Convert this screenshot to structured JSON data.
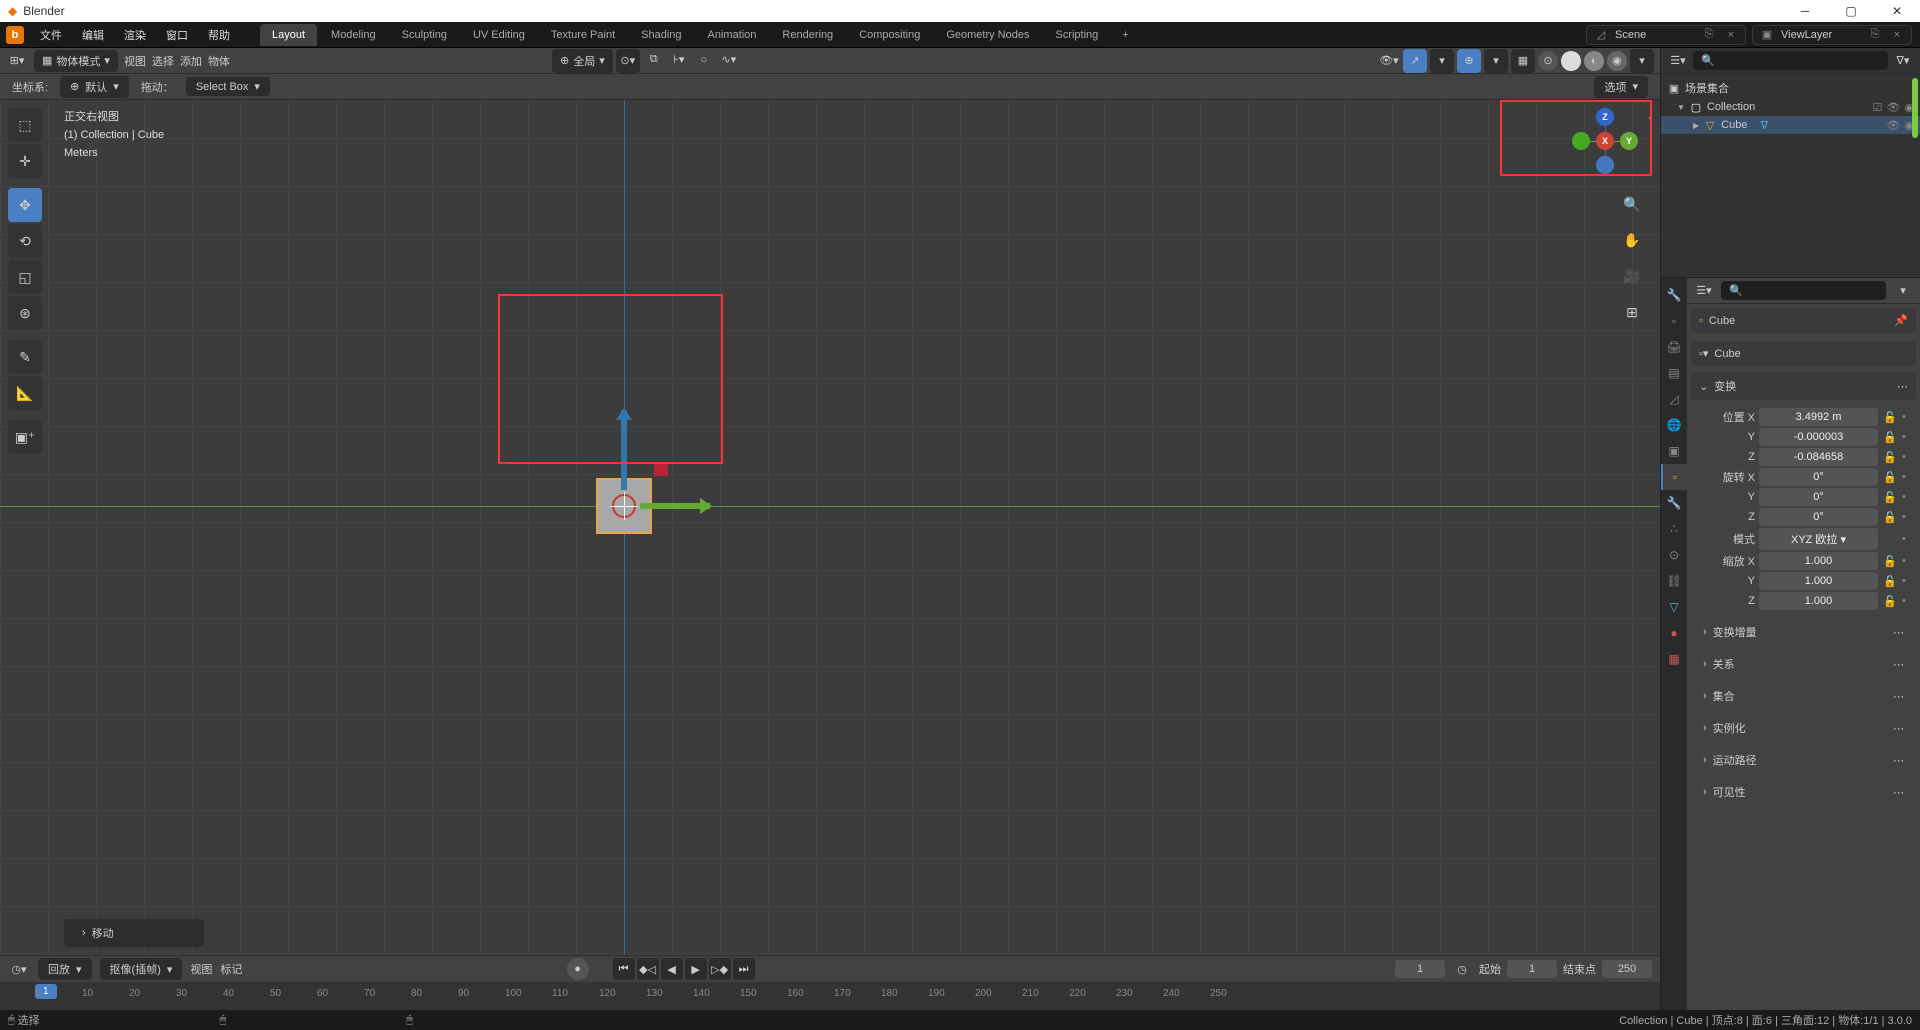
{
  "app_title": "Blender",
  "menu": {
    "file": "文件",
    "edit": "编辑",
    "render": "渲染",
    "window": "窗口",
    "help": "帮助"
  },
  "tabs": [
    "Layout",
    "Modeling",
    "Sculpting",
    "UV Editing",
    "Texture Paint",
    "Shading",
    "Animation",
    "Rendering",
    "Compositing",
    "Geometry Nodes",
    "Scripting"
  ],
  "scene_name": "Scene",
  "viewlayer_name": "ViewLayer",
  "vp_header": {
    "mode": "物体模式",
    "view": "视图",
    "select": "选择",
    "add": "添加",
    "object": "物体",
    "orient": "全局"
  },
  "vp_header2": {
    "coord": "坐标系:",
    "orient": "默认",
    "drag": "拖动：",
    "dragbox": "Select Box",
    "options": "选项"
  },
  "vp_info": {
    "view": "正交右视图",
    "path": "(1) Collection | Cube",
    "units": "Meters"
  },
  "op_panel": "移动",
  "timeline": {
    "playback": "回放",
    "keying": "抠像(插帧)",
    "view": "视图",
    "marker": "标记",
    "current": "1",
    "start_lbl": "起始",
    "start": "1",
    "end_lbl": "结束点",
    "end": "250",
    "frames": [
      "1",
      "10",
      "20",
      "30",
      "40",
      "50",
      "60",
      "70",
      "80",
      "90",
      "100",
      "110",
      "120",
      "130",
      "140",
      "150",
      "160",
      "170",
      "180",
      "190",
      "200",
      "210",
      "220",
      "230",
      "240",
      "250"
    ]
  },
  "outliner": {
    "root": "场景集合",
    "collection": "Collection",
    "cube": "Cube"
  },
  "props": {
    "cube_name": "Cube",
    "cube_data": "Cube",
    "transform": "变换",
    "loc": {
      "x_lbl": "位置 X",
      "x": "3.4992 m",
      "y_lbl": "Y",
      "y": "-0.000003",
      "z_lbl": "Z",
      "z": "-0.084658"
    },
    "rot": {
      "x_lbl": "旋转 X",
      "x": "0°",
      "y_lbl": "Y",
      "y": "0°",
      "z_lbl": "Z",
      "z": "0°",
      "mode_lbl": "模式",
      "mode": "XYZ 欧拉"
    },
    "scale": {
      "x_lbl": "缩放 X",
      "x": "1.000",
      "y_lbl": "Y",
      "y": "1.000",
      "z_lbl": "Z",
      "z": "1.000"
    },
    "delta": "变换增量",
    "relations": "关系",
    "collections": "集合",
    "instancing": "实例化",
    "motion": "运动路径",
    "vis": "可见性"
  },
  "status": {
    "select": "选择",
    "right": "Collection | Cube | 顶点:8 | 面:6 | 三角面:12 | 物体:1/1 | 3.0.0"
  }
}
